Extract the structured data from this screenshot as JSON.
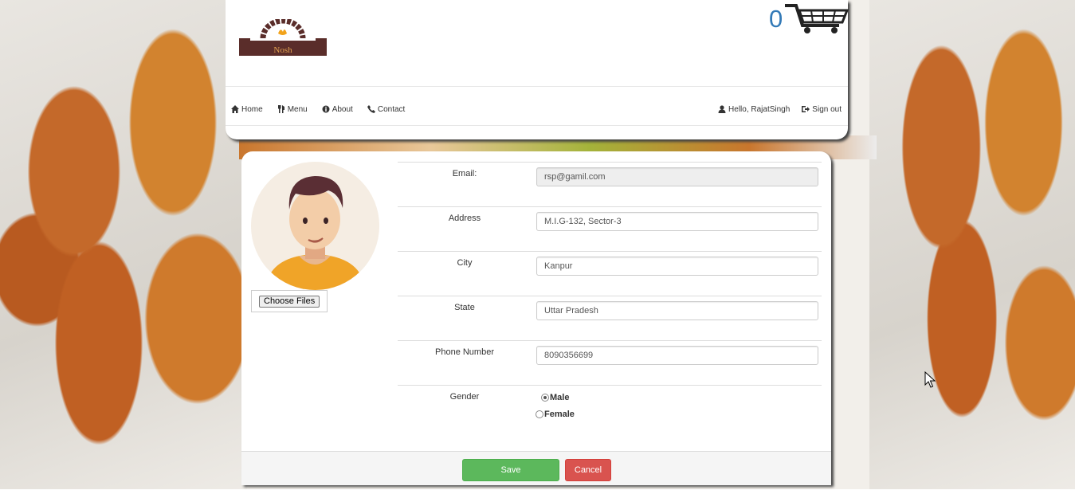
{
  "header": {
    "logo_text": "Nosh",
    "cart_count": "0",
    "nav_left": [
      {
        "label": "Home",
        "icon": "home-icon"
      },
      {
        "label": "Menu",
        "icon": "cutlery-icon"
      },
      {
        "label": "About",
        "icon": "info-icon"
      },
      {
        "label": "Contact",
        "icon": "phone-icon"
      }
    ],
    "nav_right": [
      {
        "label": "Hello, RajatSingh",
        "icon": "user-icon"
      },
      {
        "label": "Sign out",
        "icon": "sign-out-icon"
      }
    ]
  },
  "profile": {
    "choose_files_label": "Choose Files",
    "fields": [
      {
        "label": "Email:",
        "value": "rsp@gamil.com"
      },
      {
        "label": "Address",
        "value": "M.I.G-132, Sector-3"
      },
      {
        "label": "City",
        "value": "Kanpur"
      },
      {
        "label": "State",
        "value": "Uttar Pradesh"
      },
      {
        "label": "Phone Number",
        "value": "8090356699"
      }
    ],
    "gender_label": "Gender",
    "gender_options": [
      {
        "label": "Male",
        "checked": true
      },
      {
        "label": "Female",
        "checked": false
      }
    ]
  },
  "actions": {
    "save_label": "Save",
    "cancel_label": "Cancel"
  },
  "colors": {
    "save": "#5cb85c",
    "cancel": "#d9534f",
    "cart_count": "#337ab7",
    "logo_bg": "#5a2d2a"
  }
}
